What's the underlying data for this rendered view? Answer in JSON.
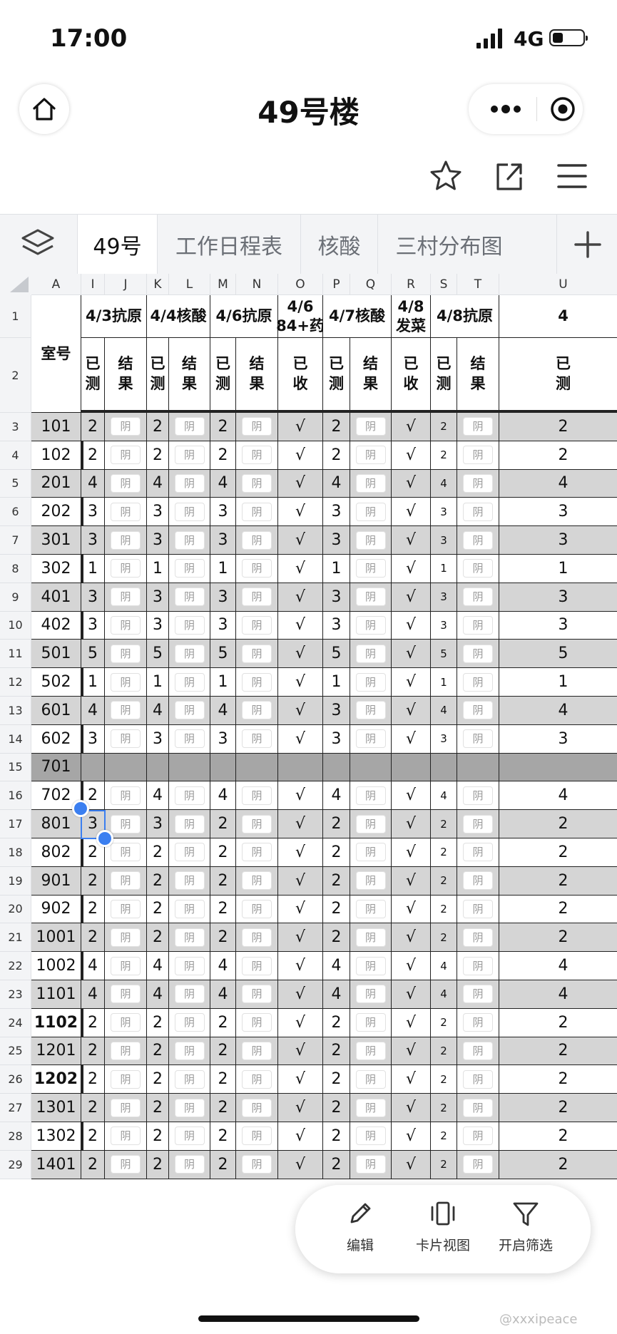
{
  "status_bar": {
    "time": "17:00",
    "network": "4G"
  },
  "title_bar": {
    "title": "49号楼"
  },
  "tabs": [
    {
      "label": "49号",
      "active": true
    },
    {
      "label": "工作日程表",
      "active": false
    },
    {
      "label": "核酸",
      "active": false
    },
    {
      "label": "三村分布图",
      "active": false
    }
  ],
  "columns": [
    "A",
    "I",
    "J",
    "K",
    "L",
    "M",
    "N",
    "O",
    "P",
    "Q",
    "R",
    "S",
    "T",
    "U"
  ],
  "header": {
    "room_label": "室号",
    "groups": [
      "4/3抗原",
      "4/4核酸",
      "4/6抗原",
      "4/6\n84+药",
      "4/7核酸",
      "4/8\n发菜",
      "4/8抗原",
      "4"
    ],
    "subs": [
      "已测",
      "结果",
      "已测",
      "结果",
      "已测",
      "结果",
      "已收",
      "已测",
      "结果",
      "已收",
      "已测",
      "结果",
      "已测"
    ]
  },
  "rows": [
    {
      "num": "3",
      "room": "101",
      "c": [
        "2",
        "阴",
        "2",
        "阴",
        "2",
        "阴",
        "√",
        "2",
        "阴",
        "√",
        "2",
        "阴",
        "2"
      ]
    },
    {
      "num": "4",
      "room": "102",
      "c": [
        "2",
        "阴",
        "2",
        "阴",
        "2",
        "阴",
        "√",
        "2",
        "阴",
        "√",
        "2",
        "阴",
        "2"
      ]
    },
    {
      "num": "5",
      "room": "201",
      "c": [
        "4",
        "阴",
        "4",
        "阴",
        "4",
        "阴",
        "√",
        "4",
        "阴",
        "√",
        "4",
        "阴",
        "4"
      ]
    },
    {
      "num": "6",
      "room": "202",
      "c": [
        "3",
        "阴",
        "3",
        "阴",
        "3",
        "阴",
        "√",
        "3",
        "阴",
        "√",
        "3",
        "阴",
        "3"
      ]
    },
    {
      "num": "7",
      "room": "301",
      "c": [
        "3",
        "阴",
        "3",
        "阴",
        "3",
        "阴",
        "√",
        "3",
        "阴",
        "√",
        "3",
        "阴",
        "3"
      ]
    },
    {
      "num": "8",
      "room": "302",
      "c": [
        "1",
        "阴",
        "1",
        "阴",
        "1",
        "阴",
        "√",
        "1",
        "阴",
        "√",
        "1",
        "阴",
        "1"
      ]
    },
    {
      "num": "9",
      "room": "401",
      "c": [
        "3",
        "阴",
        "3",
        "阴",
        "3",
        "阴",
        "√",
        "3",
        "阴",
        "√",
        "3",
        "阴",
        "3"
      ]
    },
    {
      "num": "10",
      "room": "402",
      "c": [
        "3",
        "阴",
        "3",
        "阴",
        "3",
        "阴",
        "√",
        "3",
        "阴",
        "√",
        "3",
        "阴",
        "3"
      ]
    },
    {
      "num": "11",
      "room": "501",
      "c": [
        "5",
        "阴",
        "5",
        "阴",
        "5",
        "阴",
        "√",
        "5",
        "阴",
        "√",
        "5",
        "阴",
        "5"
      ]
    },
    {
      "num": "12",
      "room": "502",
      "c": [
        "1",
        "阴",
        "1",
        "阴",
        "1",
        "阴",
        "√",
        "1",
        "阴",
        "√",
        "1",
        "阴",
        "1"
      ]
    },
    {
      "num": "13",
      "room": "601",
      "c": [
        "4",
        "阴",
        "4",
        "阴",
        "4",
        "阴",
        "√",
        "3",
        "阴",
        "√",
        "4",
        "阴",
        "4"
      ]
    },
    {
      "num": "14",
      "room": "602",
      "c": [
        "3",
        "阴",
        "3",
        "阴",
        "3",
        "阴",
        "√",
        "3",
        "阴",
        "√",
        "3",
        "阴",
        "3"
      ]
    },
    {
      "num": "15",
      "room": "701",
      "c": [
        "",
        "",
        "",
        "",
        "",
        "",
        "",
        "",
        "",
        "",
        "",
        "",
        ""
      ],
      "empty": true
    },
    {
      "num": "16",
      "room": "702",
      "c": [
        "2",
        "阴",
        "4",
        "阴",
        "4",
        "阴",
        "√",
        "4",
        "阴",
        "√",
        "4",
        "阴",
        "4"
      ]
    },
    {
      "num": "17",
      "room": "801",
      "c": [
        "3",
        "阴",
        "3",
        "阴",
        "2",
        "阴",
        "√",
        "2",
        "阴",
        "√",
        "2",
        "阴",
        "2"
      ]
    },
    {
      "num": "18",
      "room": "802",
      "c": [
        "2",
        "阴",
        "2",
        "阴",
        "2",
        "阴",
        "√",
        "2",
        "阴",
        "√",
        "2",
        "阴",
        "2"
      ]
    },
    {
      "num": "19",
      "room": "901",
      "c": [
        "2",
        "阴",
        "2",
        "阴",
        "2",
        "阴",
        "√",
        "2",
        "阴",
        "√",
        "2",
        "阴",
        "2"
      ]
    },
    {
      "num": "20",
      "room": "902",
      "c": [
        "2",
        "阴",
        "2",
        "阴",
        "2",
        "阴",
        "√",
        "2",
        "阴",
        "√",
        "2",
        "阴",
        "2"
      ]
    },
    {
      "num": "21",
      "room": "1001",
      "c": [
        "2",
        "阴",
        "2",
        "阴",
        "2",
        "阴",
        "√",
        "2",
        "阴",
        "√",
        "2",
        "阴",
        "2"
      ]
    },
    {
      "num": "22",
      "room": "1002",
      "c": [
        "4",
        "阴",
        "4",
        "阴",
        "4",
        "阴",
        "√",
        "4",
        "阴",
        "√",
        "4",
        "阴",
        "4"
      ]
    },
    {
      "num": "23",
      "room": "1101",
      "c": [
        "4",
        "阴",
        "4",
        "阴",
        "4",
        "阴",
        "√",
        "4",
        "阴",
        "√",
        "4",
        "阴",
        "4"
      ]
    },
    {
      "num": "24",
      "room": "1102",
      "bold": true,
      "c": [
        "2",
        "阴",
        "2",
        "阴",
        "2",
        "阴",
        "√",
        "2",
        "阴",
        "√",
        "2",
        "阴",
        "2"
      ]
    },
    {
      "num": "25",
      "room": "1201",
      "c": [
        "2",
        "阴",
        "2",
        "阴",
        "2",
        "阴",
        "√",
        "2",
        "阴",
        "√",
        "2",
        "阴",
        "2"
      ]
    },
    {
      "num": "26",
      "room": "1202",
      "bold": true,
      "c": [
        "2",
        "阴",
        "2",
        "阴",
        "2",
        "阴",
        "√",
        "2",
        "阴",
        "√",
        "2",
        "阴",
        "2"
      ]
    },
    {
      "num": "27",
      "room": "1301",
      "c": [
        "2",
        "阴",
        "2",
        "阴",
        "2",
        "阴",
        "√",
        "2",
        "阴",
        "√",
        "2",
        "阴",
        "2"
      ]
    },
    {
      "num": "28",
      "room": "1302",
      "c": [
        "2",
        "阴",
        "2",
        "阴",
        "2",
        "阴",
        "√",
        "2",
        "阴",
        "√",
        "2",
        "阴",
        "2"
      ]
    },
    {
      "num": "29",
      "room": "1401",
      "c": [
        "2",
        "阴",
        "2",
        "阴",
        "2",
        "阴",
        "√",
        "2",
        "阴",
        "√",
        "2",
        "阴",
        "2"
      ]
    }
  ],
  "floating_bar": {
    "edit": "编辑",
    "card_view": "卡片视图",
    "filter": "开启筛选"
  },
  "watermark": "@xxxipeace",
  "colors": {
    "accent": "#3b7ff0",
    "shaded_row": "#d5d5d5",
    "empty_row": "#a6a6a6"
  }
}
